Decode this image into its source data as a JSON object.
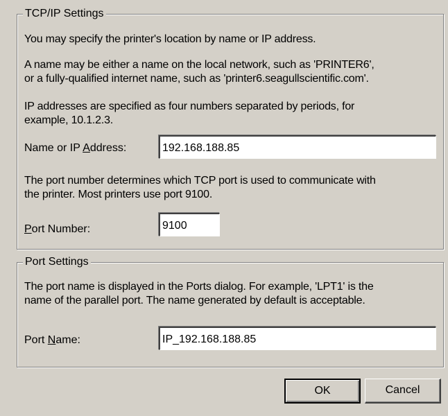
{
  "tcpip": {
    "title": "TCP/IP Settings",
    "desc1": "You may specify the printer's location by name or IP address.",
    "desc2": "A name may be either a name on the local network, such as 'PRINTER6',\nor a fully-qualified internet name, such as 'printer6.seagullscientific.com'.",
    "desc3": "IP addresses are specified as four numbers separated by periods, for\nexample, 10.1.2.3.",
    "address_label_pre": "Name or IP ",
    "address_label_mnemonic": "A",
    "address_label_post": "ddress:",
    "address_value": "192.168.188.85",
    "port_desc": "The port number determines which TCP port is used to communicate with\nthe printer.  Most printers use port 9100.",
    "port_label_mnemonic": "P",
    "port_label_post": "ort Number:",
    "port_value": "9100"
  },
  "port_settings": {
    "title": "Port Settings",
    "desc": "The port name is displayed in the Ports dialog.  For example, 'LPT1' is the\nname of the parallel port.  The name generated by default is acceptable.",
    "name_label_pre": "Port ",
    "name_label_mnemonic": "N",
    "name_label_post": "ame:",
    "name_value": "IP_192.168.188.85"
  },
  "buttons": {
    "ok": "OK",
    "cancel": "Cancel"
  }
}
